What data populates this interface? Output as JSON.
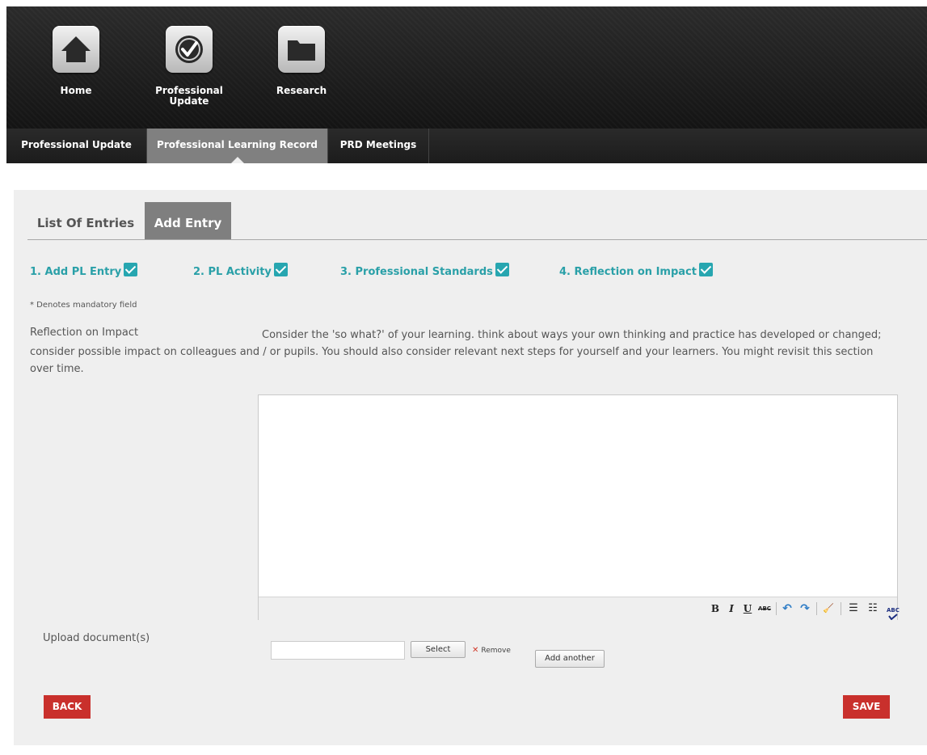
{
  "top_nav": {
    "items": [
      {
        "label": "Home",
        "icon": "home-icon"
      },
      {
        "label": "Professional\nUpdate",
        "icon": "checkmark-circle-icon"
      },
      {
        "label": "Research",
        "icon": "folder-icon"
      }
    ]
  },
  "main_tabs": [
    {
      "label": "Professional Update",
      "active": false
    },
    {
      "label": "Professional Learning Record",
      "active": true
    },
    {
      "label": "PRD Meetings",
      "active": false
    }
  ],
  "sub_tabs": [
    {
      "label": "List Of Entries",
      "active": false
    },
    {
      "label": "Add Entry",
      "active": true
    }
  ],
  "steps": [
    {
      "label": "1. Add PL Entry",
      "complete": true
    },
    {
      "label": "2. PL Activity",
      "complete": true
    },
    {
      "label": "3. Professional Standards",
      "complete": true
    },
    {
      "label": "4. Reflection on Impact",
      "complete": true
    }
  ],
  "form": {
    "mandatory_note": "* Denotes mandatory field",
    "reflection_label": "Reflection on Impact",
    "reflection_help": "Consider the 'so what?' of your learning. think about ways your own thinking and practice has developed or changed; consider possible impact on colleagues and / or pupils. You should also consider relevant next steps for yourself and your learners. You might revisit this section over time.",
    "reflection_value": "",
    "upload_label": "Upload document(s)",
    "file_value": "",
    "select_label": "Select",
    "remove_label": "Remove",
    "add_another_label": "Add another",
    "spell_label": "ABC"
  },
  "toolbar": {
    "bold": "B",
    "italic": "I",
    "underline": "U",
    "strike": "ABC",
    "undo": "↶",
    "redo": "↷",
    "clear": "🧹",
    "bullets": "☰",
    "numbers": "☷"
  },
  "actions": {
    "back_label": "BACK",
    "save_label": "SAVE"
  },
  "colors": {
    "accent_teal": "#2aa0a8",
    "button_red": "#c9302c",
    "active_tab_gray": "#808080"
  }
}
